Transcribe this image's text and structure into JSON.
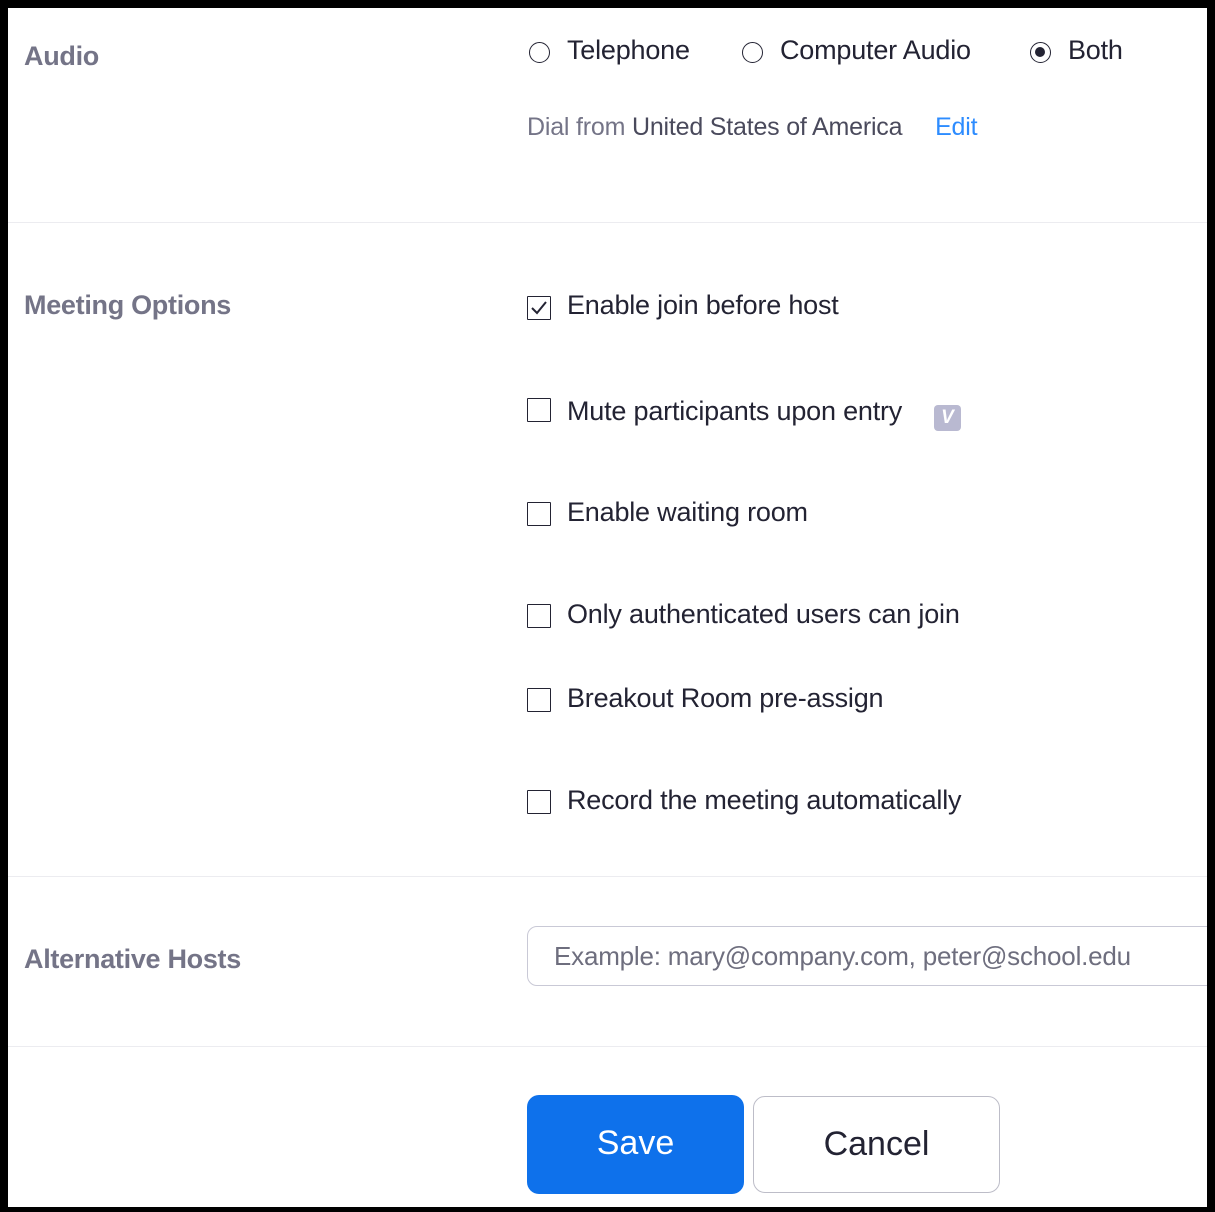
{
  "audio": {
    "label": "Audio",
    "options": [
      {
        "label": "Telephone",
        "selected": false
      },
      {
        "label": "Computer Audio",
        "selected": false
      },
      {
        "label": "Both",
        "selected": true
      }
    ],
    "dial_label": "Dial from",
    "dial_country": "United States of America",
    "edit_label": "Edit"
  },
  "meeting_options": {
    "label": "Meeting Options",
    "items": [
      {
        "label": "Enable join before host",
        "checked": true
      },
      {
        "label": "Mute participants upon entry",
        "checked": false,
        "badge": "V"
      },
      {
        "label": "Enable waiting room",
        "checked": false
      },
      {
        "label": "Only authenticated users can join",
        "checked": false
      },
      {
        "label": "Breakout Room pre-assign",
        "checked": false
      },
      {
        "label": "Record the meeting automatically",
        "checked": false
      }
    ]
  },
  "alternative_hosts": {
    "label": "Alternative Hosts",
    "placeholder": "Example: mary@company.com, peter@school.edu",
    "value": ""
  },
  "buttons": {
    "save_label": "Save",
    "cancel_label": "Cancel"
  },
  "colors": {
    "accent": "#0e71eb",
    "link": "#2d8cff",
    "label_gray": "#747487",
    "text": "#232333"
  }
}
